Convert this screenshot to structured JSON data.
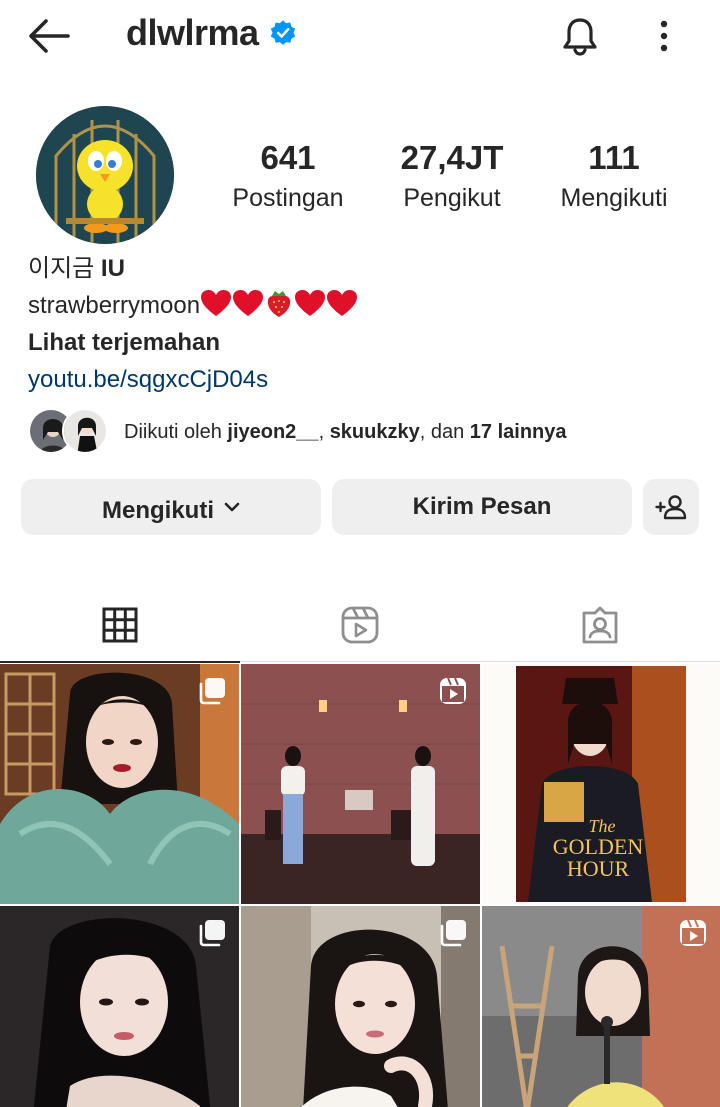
{
  "header": {
    "username": "dlwlrma",
    "verified": true,
    "back_icon": "arrow-left-icon",
    "bell_icon": "bell-icon",
    "more_icon": "more-vertical-icon"
  },
  "profile": {
    "stats": {
      "posts_count": "641",
      "posts_label": "Postingan",
      "followers_count": "27,4JT",
      "followers_label": "Pengikut",
      "following_count": "111",
      "following_label": "Mengikuti"
    },
    "bio": {
      "name_korean": "이지금 ",
      "name_latin": "IU",
      "text": "strawberrymoon",
      "emoji": [
        "red-heart",
        "red-heart",
        "strawberry",
        "red-heart",
        "red-heart"
      ],
      "translate_label": "Lihat terjemahan",
      "link": "youtu.be/sqgxcCjD04s"
    },
    "followed_by": {
      "prefix": "Diikuti oleh ",
      "user1": "jiyeon2__",
      "sep1": ", ",
      "user2": "skuukzky",
      "sep2": ", dan ",
      "others": "17 lainnya"
    }
  },
  "actions": {
    "follow_label": "Mengikuti",
    "follow_chevron": "chevron-down-icon",
    "message_label": "Kirim Pesan",
    "add_user_icon": "add-user-icon"
  },
  "tabs": [
    {
      "name": "grid",
      "icon": "grid-icon",
      "active": true
    },
    {
      "name": "reels",
      "icon": "reels-icon",
      "active": false
    },
    {
      "name": "tagged",
      "icon": "tagged-icon",
      "active": false
    }
  ],
  "posts": [
    {
      "type": "carousel",
      "badge": "multiple-photos-icon"
    },
    {
      "type": "reel",
      "badge": "reels-icon"
    },
    {
      "type": "photo",
      "poster_text_1": "The",
      "poster_text_2": "GOLDEN",
      "poster_text_3": "HOUR"
    },
    {
      "type": "carousel",
      "badge": "multiple-photos-icon"
    },
    {
      "type": "carousel",
      "badge": "multiple-photos-icon"
    },
    {
      "type": "reel",
      "badge": "reels-icon"
    }
  ],
  "colors": {
    "text": "#262626",
    "link": "#00376b",
    "button_bg": "#efefef",
    "verified_blue": "#0095f6",
    "heart_red": "#e0102a"
  }
}
